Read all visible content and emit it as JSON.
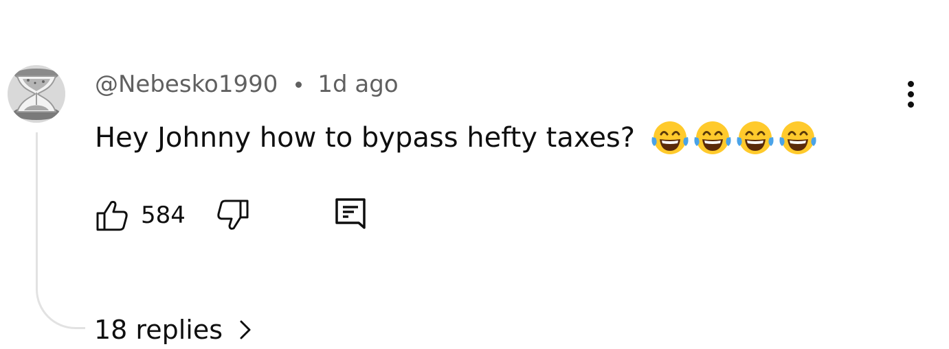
{
  "comment": {
    "author": "@Nebesko1990",
    "time_ago": "1d ago",
    "text": "Hey Johnny how to bypass hefty taxes?",
    "emojis": [
      "face-with-tears-of-joy",
      "face-with-tears-of-joy",
      "face-with-tears-of-joy",
      "face-with-tears-of-joy"
    ],
    "likes": "584",
    "replies_label": "18 replies"
  },
  "icons": {
    "avatar": "hourglass-avatar",
    "more": "more-vertical-icon",
    "like": "thumbs-up-icon",
    "dislike": "thumbs-down-icon",
    "reply": "reply-comment-icon",
    "chevron": "chevron-right-icon"
  },
  "colors": {
    "text": "#0f0f0f",
    "secondary_text": "#606060",
    "thread_line": "#e2e2e2",
    "emoji_face": "#ffca2c",
    "emoji_tears": "#4aa3e8"
  }
}
